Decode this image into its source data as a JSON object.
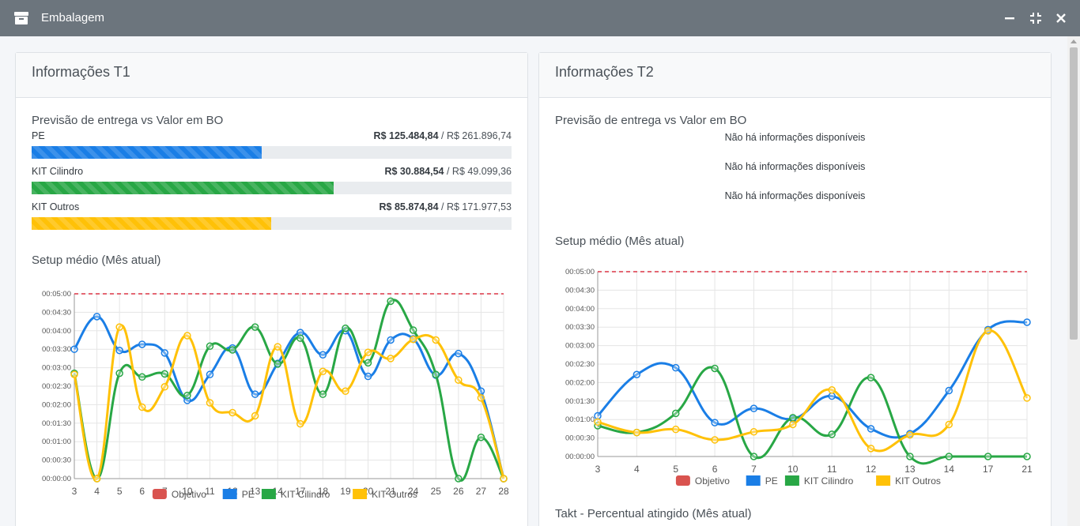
{
  "window": {
    "title": "Embalagem",
    "icon": "box-icon"
  },
  "window_controls": [
    {
      "name": "minimize-button",
      "icon": "minimize-icon"
    },
    {
      "name": "compress-button",
      "icon": "compress-icon"
    },
    {
      "name": "close-button",
      "icon": "close-icon"
    }
  ],
  "colors": {
    "pe": "#1a7ee6",
    "kit_cilindro": "#28a745",
    "kit_outros": "#ffc107",
    "objetivo": "#dc3545",
    "titlebar": "#6c757d"
  },
  "t1": {
    "title": "Informações T1",
    "forecast_title": "Previsão de entrega vs Valor em BO",
    "bars": [
      {
        "label": "PE",
        "value": "R$ 125.484,84",
        "total": " / R$ 261.896,74",
        "fraction": 0.479,
        "color": "#1a7ee6"
      },
      {
        "label": "KIT Cilindro",
        "value": "R$ 30.884,54",
        "total": " / R$ 49.099,36",
        "fraction": 0.629,
        "color": "#28a745"
      },
      {
        "label": "KIT Outros",
        "value": "R$ 85.874,84",
        "total": " / R$ 171.977,53",
        "fraction": 0.499,
        "color": "#ffc107"
      }
    ],
    "setup_title": "Setup médio (Mês atual)"
  },
  "t2": {
    "title": "Informações T2",
    "forecast_title": "Previsão de entrega vs Valor em BO",
    "no_info": [
      "Não há informações disponíveis",
      "Não há informações disponíveis",
      "Não há informações disponíveis"
    ],
    "setup_title": "Setup médio (Mês atual)",
    "takt_title": "Takt - Percentual atingido (Mês atual)"
  },
  "chart_data": [
    {
      "type": "line",
      "x": [
        "3",
        "4",
        "5",
        "6",
        "7",
        "10",
        "11",
        "12",
        "13",
        "14",
        "17",
        "18",
        "19",
        "20",
        "21",
        "24",
        "25",
        "26",
        "27",
        "28"
      ],
      "y_ticks": [
        "00:00:00",
        "00:00:30",
        "00:01:00",
        "00:01:30",
        "00:02:00",
        "00:02:30",
        "00:03:00",
        "00:03:30",
        "00:04:00",
        "00:04:30",
        "00:05:00"
      ],
      "ylim": [
        0,
        300
      ],
      "objetivo": 300,
      "series": [
        {
          "name": "PE",
          "color": "#1a7ee6",
          "values": [
            210,
            263,
            208,
            218,
            204,
            127,
            169,
            212,
            137,
            187,
            237,
            201,
            240,
            166,
            225,
            227,
            168,
            203,
            142,
            0
          ]
        },
        {
          "name": "KIT Cilindro",
          "color": "#28a745",
          "values": [
            171,
            0,
            171,
            165,
            170,
            135,
            215,
            209,
            246,
            186,
            228,
            137,
            244,
            188,
            288,
            241,
            169,
            0,
            67,
            0
          ]
        },
        {
          "name": "KIT Outros",
          "color": "#ffc107",
          "values": [
            169,
            0,
            246,
            116,
            149,
            232,
            123,
            107,
            102,
            214,
            89,
            174,
            142,
            205,
            195,
            226,
            225,
            160,
            131,
            0
          ]
        }
      ],
      "legend": [
        "Objetivo",
        "PE",
        "KIT Cilindro",
        "KIT Outros"
      ],
      "legend_position": "bottom",
      "grid": true
    },
    {
      "type": "line",
      "x": [
        "3",
        "4",
        "5",
        "6",
        "7",
        "10",
        "11",
        "12",
        "13",
        "14",
        "17",
        "21"
      ],
      "y_ticks": [
        "00:00:00",
        "00:00:30",
        "00:01:00",
        "00:01:30",
        "00:02:00",
        "00:02:30",
        "00:03:00",
        "00:03:30",
        "00:04:00",
        "00:04:30",
        "00:05:00"
      ],
      "ylim": [
        0,
        300
      ],
      "objetivo": 300,
      "series": [
        {
          "name": "PE",
          "color": "#1a7ee6",
          "values": [
            66,
            133,
            144,
            55,
            78,
            61,
            98,
            45,
            37,
            107,
            206,
            218
          ]
        },
        {
          "name": "KIT Cilindro",
          "color": "#28a745",
          "values": [
            50,
            39,
            70,
            143,
            0,
            63,
            36,
            128,
            0,
            0,
            0,
            0
          ]
        },
        {
          "name": "KIT Outros",
          "color": "#ffc107",
          "values": [
            56,
            39,
            44,
            27,
            40,
            52,
            108,
            13,
            35,
            52,
            204,
            95
          ]
        }
      ],
      "legend": [
        "Objetivo",
        "PE",
        "KIT Cilindro",
        "KIT Outros"
      ],
      "legend_position": "bottom",
      "grid": true
    }
  ]
}
